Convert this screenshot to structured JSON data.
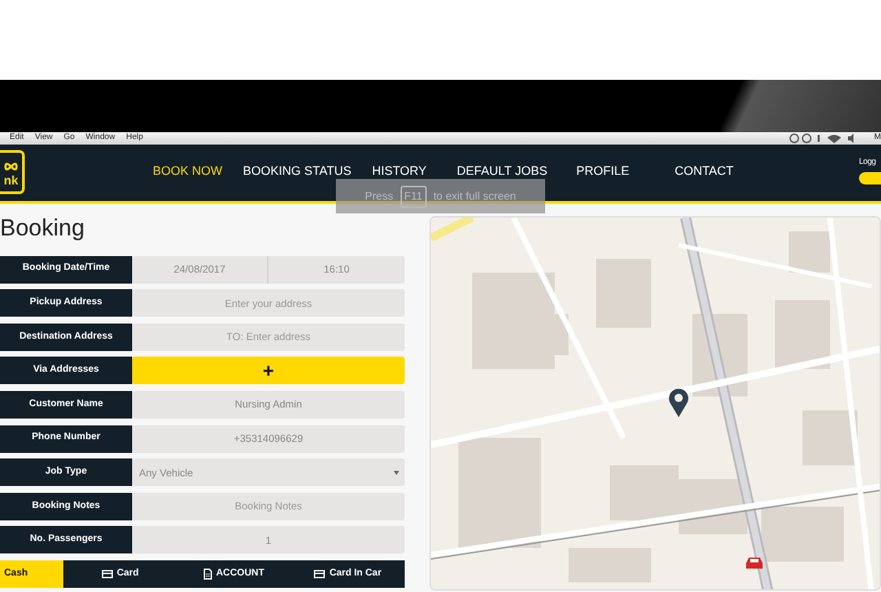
{
  "menubar": {
    "items": [
      "Edit",
      "View",
      "Go",
      "Window",
      "Help"
    ],
    "right_text": "M"
  },
  "navbar": {
    "logo_text": "nk",
    "items": [
      {
        "label": "BOOK NOW",
        "selected": true
      },
      {
        "label": "BOOKING STATUS",
        "selected": false
      },
      {
        "label": "HISTORY",
        "selected": false
      },
      {
        "label": "DEFAULT JOBS",
        "selected": false
      },
      {
        "label": "PROFILE",
        "selected": false
      },
      {
        "label": "CONTACT",
        "selected": false
      }
    ],
    "user_text": "Logg"
  },
  "fullscreen_hint": {
    "before": "Press",
    "key": "F11",
    "after": "to exit full screen"
  },
  "page_title": "Booking",
  "form": [
    {
      "kind": "datetime",
      "label": "Booking Date/Time",
      "date": "24/08/2017",
      "time": "16:10"
    },
    {
      "kind": "text",
      "label": "Pickup Address",
      "placeholder": "Enter your address"
    },
    {
      "kind": "text",
      "label": "Destination Address",
      "placeholder": "TO: Enter address"
    },
    {
      "kind": "add",
      "label": "Via Addresses",
      "button": "+"
    },
    {
      "kind": "text",
      "label": "Customer Name",
      "value": "Nursing Admin"
    },
    {
      "kind": "text",
      "label": "Phone Number",
      "value": "+35314096629"
    },
    {
      "kind": "select",
      "label": "Job Type",
      "value": "Any Vehicle"
    },
    {
      "kind": "text",
      "label": "Booking Notes",
      "placeholder": "Booking Notes"
    },
    {
      "kind": "text",
      "label": "No. Passengers",
      "value": "1"
    }
  ],
  "payment": [
    {
      "label": "Cash",
      "kind": "plain",
      "selected": true
    },
    {
      "label": "Card",
      "kind": "card",
      "selected": false
    },
    {
      "label": "ACCOUNT",
      "kind": "document",
      "selected": false
    },
    {
      "label": "Card In Car",
      "kind": "card",
      "selected": false
    }
  ]
}
